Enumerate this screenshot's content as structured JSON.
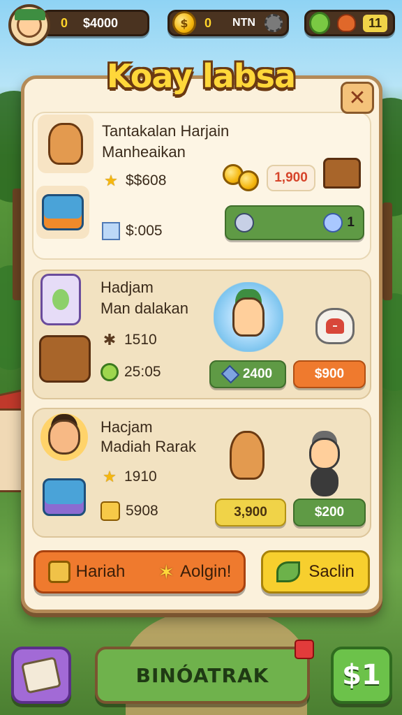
{
  "hud": {
    "player_level": "0",
    "player_currency": "$4000",
    "coins_count": "0",
    "coins_label": "NTN",
    "gems_count": "11"
  },
  "panel": {
    "title": "Koay labsa",
    "close_label": "✕"
  },
  "cards": [
    {
      "name_line1": "Tantakalan Harjain",
      "name_line2": "Manheaikan",
      "stat1": "$$608",
      "stat2": "$:005",
      "price1": "1,900",
      "price2": "1"
    },
    {
      "name_line1": "Hadjam",
      "name_line2": "Man dalakan",
      "stat1": "1510",
      "stat2": "25:05",
      "price1": "2400",
      "price2": "$900"
    },
    {
      "name_line1": "Hacjam",
      "name_line2": "Madiah Rarak",
      "stat1": "1910",
      "stat2": "5908",
      "price1": "3,900",
      "price2": "$200"
    }
  ],
  "bottom_buttons": {
    "left_label": "Hariah",
    "middle_label": "Aolgin!",
    "right_label": "Saclin"
  },
  "footer": {
    "main_label": "BINÓATRAK",
    "right_label": "$1"
  },
  "colors": {
    "panel_bg": "#fbf1dc",
    "title_fill": "#ffd73a",
    "green": "#5f9a45",
    "orange": "#ef7a2e",
    "yellow": "#f0d348",
    "purple": "#a26ad6"
  },
  "icons": {
    "avatar": "player-avatar-icon",
    "coin": "coin-icon",
    "settings": "gear-icon",
    "gem": "gem-icon",
    "chest": "treasure-chest-icon",
    "star": "star-icon",
    "cube": "cube-icon",
    "lock": "lock-icon",
    "leaf": "leaf-icon",
    "note": "note-icon"
  }
}
